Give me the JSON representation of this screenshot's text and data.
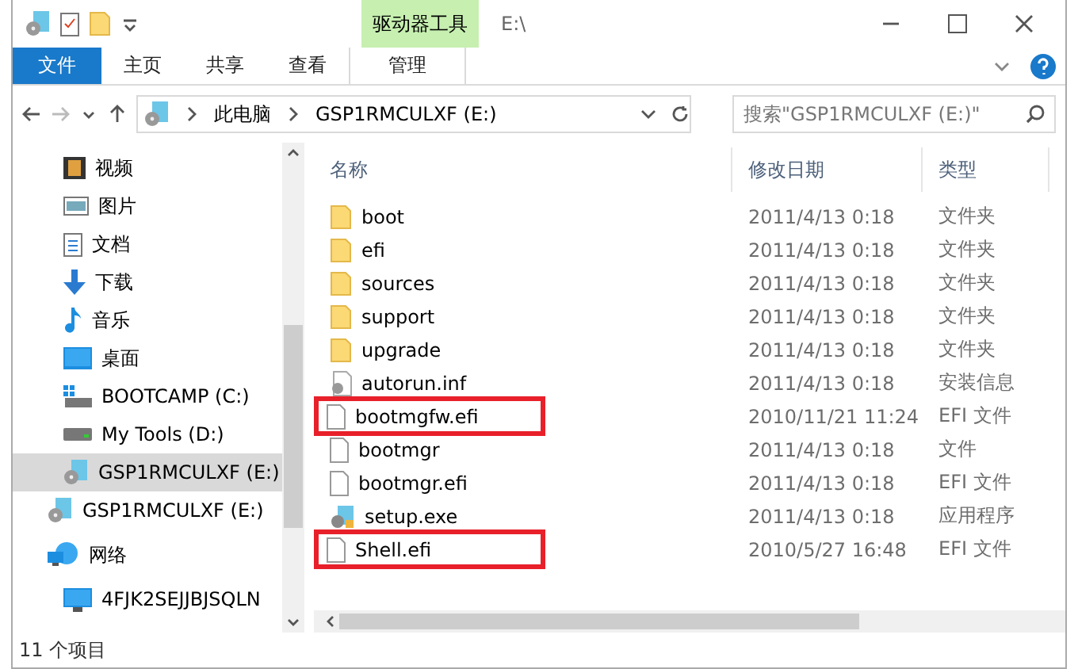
{
  "window": {
    "title": "E:\\",
    "context_tab": "驱动器工具"
  },
  "ribbon_tabs": [
    {
      "label": "文件",
      "kind": "file",
      "selected": false
    },
    {
      "label": "主页",
      "kind": "tab",
      "selected": false
    },
    {
      "label": "共享",
      "kind": "tab",
      "selected": false
    },
    {
      "label": "查看",
      "kind": "tab",
      "selected": false
    },
    {
      "label": "管理",
      "kind": "context",
      "selected": false
    }
  ],
  "address": {
    "crumbs": [
      "此电脑",
      "GSP1RMCULXF (E:)"
    ],
    "search_placeholder": "搜索\"GSP1RMCULXF (E:)\""
  },
  "nav": [
    {
      "children": [
        {
          "label": "视频",
          "kind": "video",
          "selected": false
        },
        {
          "label": "图片",
          "kind": "picture",
          "selected": false
        },
        {
          "label": "文档",
          "kind": "document",
          "selected": false
        },
        {
          "label": "下载",
          "kind": "download",
          "selected": false
        },
        {
          "label": "音乐",
          "kind": "music",
          "selected": false
        },
        {
          "label": "桌面",
          "kind": "desktop",
          "selected": false
        },
        {
          "label": "BOOTCAMP (C:)",
          "kind": "windrive",
          "selected": false
        },
        {
          "label": "My Tools (D:)",
          "kind": "drive",
          "selected": false
        },
        {
          "label": "GSP1RMCULXF (E:)",
          "kind": "dvd",
          "selected": true
        }
      ]
    },
    {
      "label": "GSP1RMCULXF (E:)",
      "kind": "dvd",
      "selected": false
    },
    {
      "label": "网络",
      "kind": "network",
      "selected": false,
      "children": [
        {
          "label": "4FJK2SEJJBJSQLN",
          "kind": "computer",
          "selected": false
        }
      ]
    }
  ],
  "table": {
    "columns": [
      "名称",
      "修改日期",
      "类型"
    ],
    "rows": [
      {
        "name": "boot",
        "date": "2011/4/13 0:18",
        "type": "文件夹",
        "kind": "folder",
        "highlighted": false
      },
      {
        "name": "efi",
        "date": "2011/4/13 0:18",
        "type": "文件夹",
        "kind": "folder",
        "highlighted": false
      },
      {
        "name": "sources",
        "date": "2011/4/13 0:18",
        "type": "文件夹",
        "kind": "folder",
        "highlighted": false
      },
      {
        "name": "support",
        "date": "2011/4/13 0:18",
        "type": "文件夹",
        "kind": "folder",
        "highlighted": false
      },
      {
        "name": "upgrade",
        "date": "2011/4/13 0:18",
        "type": "文件夹",
        "kind": "folder",
        "highlighted": false
      },
      {
        "name": "autorun.inf",
        "date": "2011/4/13 0:18",
        "type": "安装信息",
        "kind": "settings",
        "highlighted": false
      },
      {
        "name": "bootmgfw.efi",
        "date": "2010/11/21 11:24",
        "type": "EFI 文件",
        "kind": "file",
        "highlighted": true
      },
      {
        "name": "bootmgr",
        "date": "2011/4/13 0:18",
        "type": "文件",
        "kind": "file",
        "highlighted": false
      },
      {
        "name": "bootmgr.efi",
        "date": "2011/4/13 0:18",
        "type": "EFI 文件",
        "kind": "file",
        "highlighted": false
      },
      {
        "name": "setup.exe",
        "date": "2011/4/13 0:18",
        "type": "应用程序",
        "kind": "setup",
        "highlighted": false
      },
      {
        "name": "Shell.efi",
        "date": "2010/5/27 16:48",
        "type": "EFI 文件",
        "kind": "file",
        "highlighted": true
      }
    ]
  },
  "status_bar": "11 个项目"
}
